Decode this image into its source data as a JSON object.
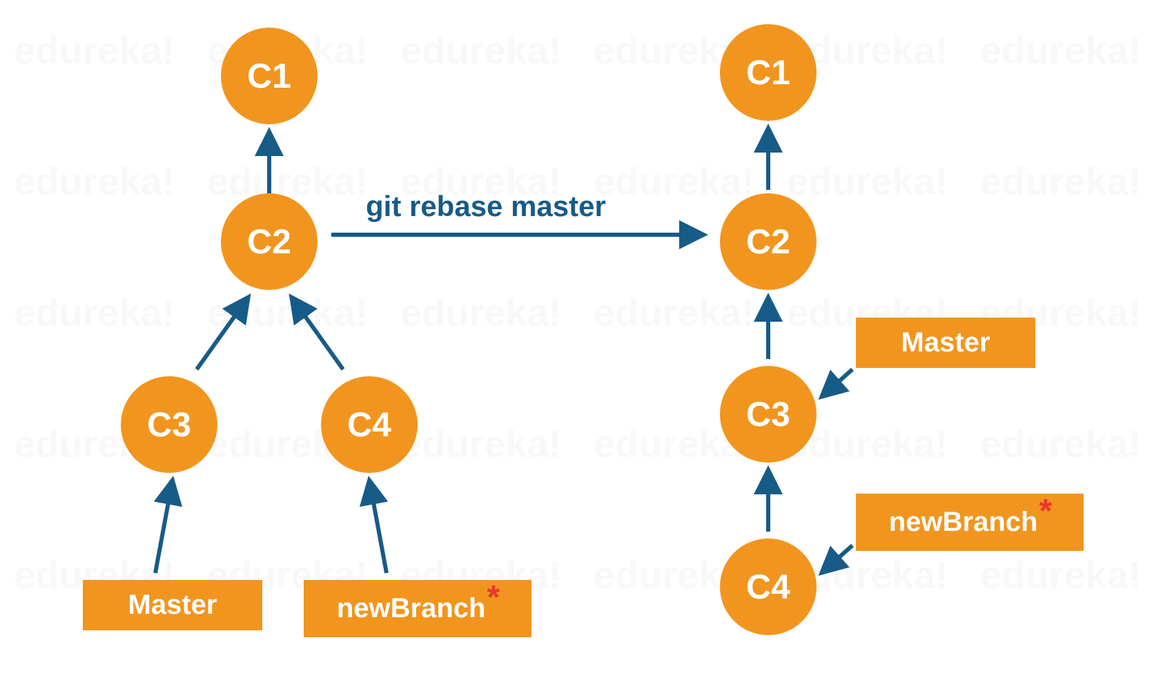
{
  "colors": {
    "orange": "#f2951e",
    "navy": "#175b87",
    "red": "#e8362d"
  },
  "command": "git rebase master",
  "left": {
    "c1": "C1",
    "c2": "C2",
    "c3": "C3",
    "c4": "C4",
    "master_label": "Master",
    "newbranch_label": "newBranch"
  },
  "right": {
    "c1": "C1",
    "c2": "C2",
    "c3": "C3",
    "c4": "C4",
    "master_label": "Master",
    "newbranch_label": "newBranch"
  },
  "watermark_text": "edureka!"
}
